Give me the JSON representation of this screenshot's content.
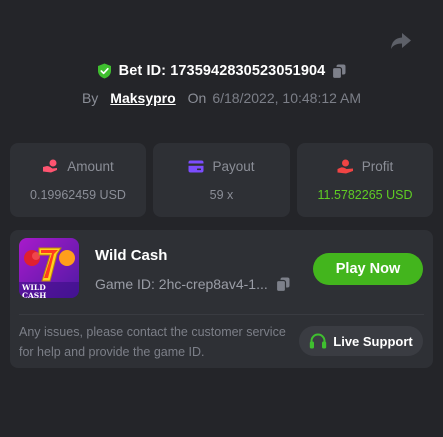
{
  "header": {
    "bet_id_label": "Bet ID: 1735942830523051904",
    "by_label": "By",
    "username": "Maksypro",
    "on_label": "On",
    "date": "6/18/2022, 10:48:12 AM"
  },
  "stats": [
    {
      "label": "Amount",
      "value": "0.19962459 USD",
      "icon": "coin-hand-icon",
      "icon_color": "#ff5470"
    },
    {
      "label": "Payout",
      "value": "59 x",
      "icon": "card-icon",
      "icon_color": "#7c4dff"
    },
    {
      "label": "Profit",
      "value": "11.5782265 USD",
      "icon": "hand-coin-icon",
      "icon_color": "#f04444",
      "value_color": "#5fce24"
    }
  ],
  "game": {
    "name": "Wild Cash",
    "game_id": "Game ID: 2hc-crep8av4-1...",
    "thumb_text": "WILD CASH",
    "play_label": "Play Now"
  },
  "support": {
    "help_text": "Any issues, please contact the customer service for help and provide the game ID.",
    "button_label": "Live Support"
  },
  "colors": {
    "background": "#242529",
    "panel": "#2e3035",
    "accent_green": "#43b51d"
  }
}
